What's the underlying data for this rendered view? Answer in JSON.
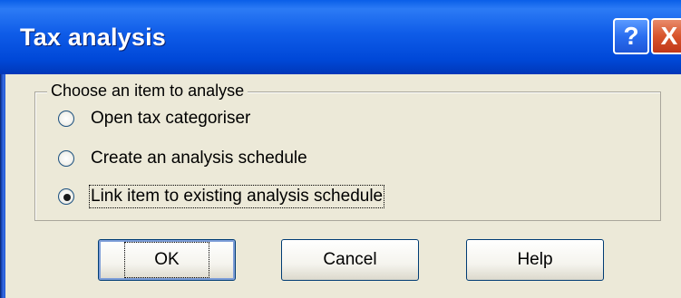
{
  "window": {
    "title": "Tax analysis",
    "help_glyph": "?",
    "close_glyph": "X"
  },
  "group": {
    "label": "Choose an item to analyse",
    "options": [
      {
        "label": "Open tax categoriser",
        "checked": false
      },
      {
        "label": "Create an analysis schedule",
        "checked": false
      },
      {
        "label": "Link item to existing analysis schedule",
        "checked": true
      }
    ]
  },
  "buttons": {
    "ok": "OK",
    "cancel": "Cancel",
    "help": "Help"
  },
  "colors": {
    "titlebar": "#0048d8",
    "dialog_bg": "#ece9d8",
    "close": "#d8542c"
  }
}
